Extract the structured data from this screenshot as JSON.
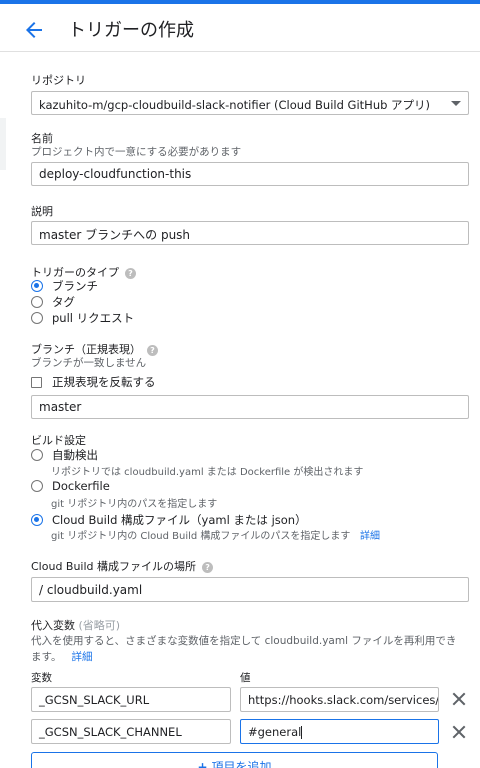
{
  "header": {
    "title": "トリガーの作成"
  },
  "repo": {
    "label": "リポジトリ",
    "value": "kazuhito-m/gcp-cloudbuild-slack-notifier (Cloud Build GitHub アプリ)"
  },
  "name": {
    "label": "名前",
    "hint": "プロジェクト内で一意にする必要があります",
    "value": "deploy-cloudfunction-this"
  },
  "description": {
    "label": "説明",
    "value": "master ブランチへの push"
  },
  "trigger_type": {
    "label": "トリガーのタイプ",
    "options": [
      "ブランチ",
      "タグ",
      "pull リクエスト"
    ],
    "selected": "ブランチ"
  },
  "branch": {
    "label": "ブランチ（正規表現）",
    "hint": "ブランチが一致しません",
    "invert_label": "正規表現を反転する",
    "value": "master"
  },
  "build_config": {
    "label": "ビルド設定",
    "options": [
      {
        "label": "自動検出",
        "hint": "リポジトリでは cloudbuild.yaml または Dockerfile が検出されます"
      },
      {
        "label": "Dockerfile",
        "hint": "git リポジトリ内のパスを指定します"
      },
      {
        "label": "Cloud Build 構成ファイル（yaml または json）",
        "hint": "git リポジトリ内の Cloud Build 構成ファイルのパスを指定します",
        "link": "詳細"
      }
    ],
    "selected_index": 2
  },
  "config_location": {
    "label": "Cloud Build 構成ファイルの場所",
    "prefix": "/",
    "value": "cloudbuild.yaml"
  },
  "substitutions": {
    "label": "代入変数",
    "optional": "(省略可)",
    "hint": "代入を使用すると、さまざまな変数値を指定して cloudbuild.yaml ファイルを再利用でき",
    "hint2": "ます。",
    "link": "詳細",
    "col_var": "変数",
    "col_val": "値",
    "rows": [
      {
        "var": "_GCSN_SLACK_URL",
        "val": "https://hooks.slack.com/services/"
      },
      {
        "var": "_GCSN_SLACK_CHANNEL",
        "val": "#general"
      }
    ],
    "add_label": "項目を追加"
  }
}
